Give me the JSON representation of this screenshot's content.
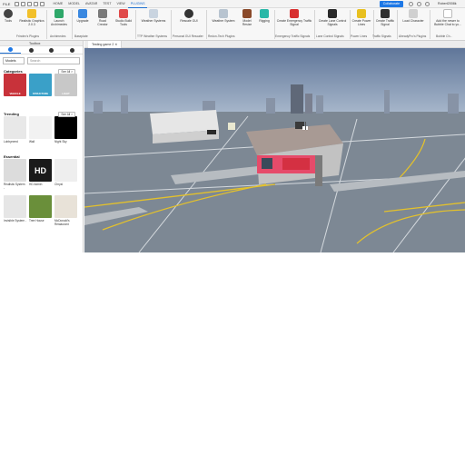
{
  "menubar": {
    "file": "FILE",
    "tabs": [
      "HOME",
      "MODEL",
      "AVATAR",
      "TEST",
      "VIEW",
      "PLUGINS"
    ],
    "active_tab": "PLUGINS",
    "collaborate": "Collaborate",
    "user": "Robert2008k"
  },
  "ribbon": {
    "plugins": [
      {
        "label": "Tools",
        "group": ""
      },
      {
        "label": "Realistic Graphics 2.0.3",
        "group": "Frindex's Plugins"
      },
      {
        "label": "Launch Archimedes",
        "group": "Archimedes"
      },
      {
        "label": "Upgrade",
        "group": "Baseplate"
      },
      {
        "label": "Road Creator",
        "group": ""
      },
      {
        "label": "Studio Build Tools",
        "group": ""
      },
      {
        "label": "Weather Systems",
        "group": "TTP Weather Systems"
      },
      {
        "label": "Rescale GUI",
        "group": "Personal GUI Rescaler"
      },
      {
        "label": "Weather System",
        "group": "Redon-Tech Plugins"
      },
      {
        "label": "Model Resize",
        "group": ""
      },
      {
        "label": "Rigging",
        "group": ""
      },
      {
        "label": "Create Emergency Traffic Signal",
        "group": "Emergency Traffic Signals"
      },
      {
        "label": "Create Lane Control Signals",
        "group": "Lane Control Signals"
      },
      {
        "label": "Create Power Lines",
        "group": "Power Lines"
      },
      {
        "label": "Create Traffic Signal",
        "group": "Traffic Signals"
      },
      {
        "label": "Load Character",
        "group": "AlreadyPro's Plugins"
      },
      {
        "label": "Add the newer to Bubble Chat to yo...",
        "group": "Bubble Ch..."
      }
    ]
  },
  "toolbox": {
    "title": "Toolbox",
    "category_select": "Models",
    "search_placeholder": "Search",
    "categories_heading": "Categories",
    "trending_heading": "Trending",
    "essential_heading": "Essential",
    "see_all": "See All >",
    "categories": [
      {
        "caption": "",
        "overlay": "VEHICLE",
        "color": "#c8323a"
      },
      {
        "caption": "",
        "overlay": "STRUCTURE",
        "color": "#3aa0c8"
      },
      {
        "caption": "",
        "overlay": "LIGHT",
        "color": "#c8c8c8"
      }
    ],
    "trending": [
      {
        "caption": "Lobbyneed",
        "color": "#e8e8e8"
      },
      {
        "caption": "Wall",
        "color": "#f2f2f2"
      },
      {
        "caption": "Night Sky",
        "color": "#000000"
      }
    ],
    "essential": [
      {
        "caption": "Realistic System -",
        "color": "#dcdcdc"
      },
      {
        "caption": "HD Admin",
        "color": "#1a1a1a"
      },
      {
        "caption": "Chrysl",
        "color": "#eeeeee"
      },
      {
        "caption": "Invisible System -",
        "color": "#e6e6e6"
      },
      {
        "caption": "Tree House",
        "color": "#6a8f3a"
      },
      {
        "caption": "McDonald's Restaurant",
        "color": "#e8e2d8"
      }
    ]
  },
  "viewport": {
    "tab_label": "Testing game 2 ✕"
  }
}
